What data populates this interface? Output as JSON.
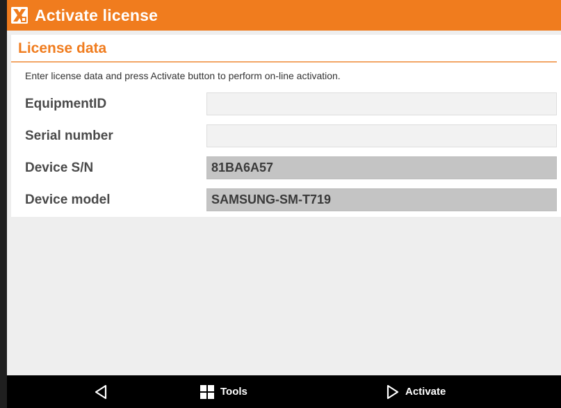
{
  "window": {
    "title": "Activate license",
    "accent_color": "#f07c1e"
  },
  "section": {
    "title": "License data",
    "instructions": "Enter license data and press Activate button to perform on-line activation."
  },
  "fields": [
    {
      "label": "EquipmentID",
      "value": "",
      "editable": true
    },
    {
      "label": "Serial number",
      "value": "",
      "editable": true
    },
    {
      "label": "Device S/N",
      "value": "81BA6A57",
      "editable": false
    },
    {
      "label": "Device model",
      "value": "SAMSUNG-SM-T719",
      "editable": false
    }
  ],
  "navbar": {
    "back_icon": "back-triangle-icon",
    "tools_label": "Tools",
    "tools_icon": "grid-icon",
    "activate_label": "Activate",
    "activate_icon": "play-outline-icon"
  }
}
